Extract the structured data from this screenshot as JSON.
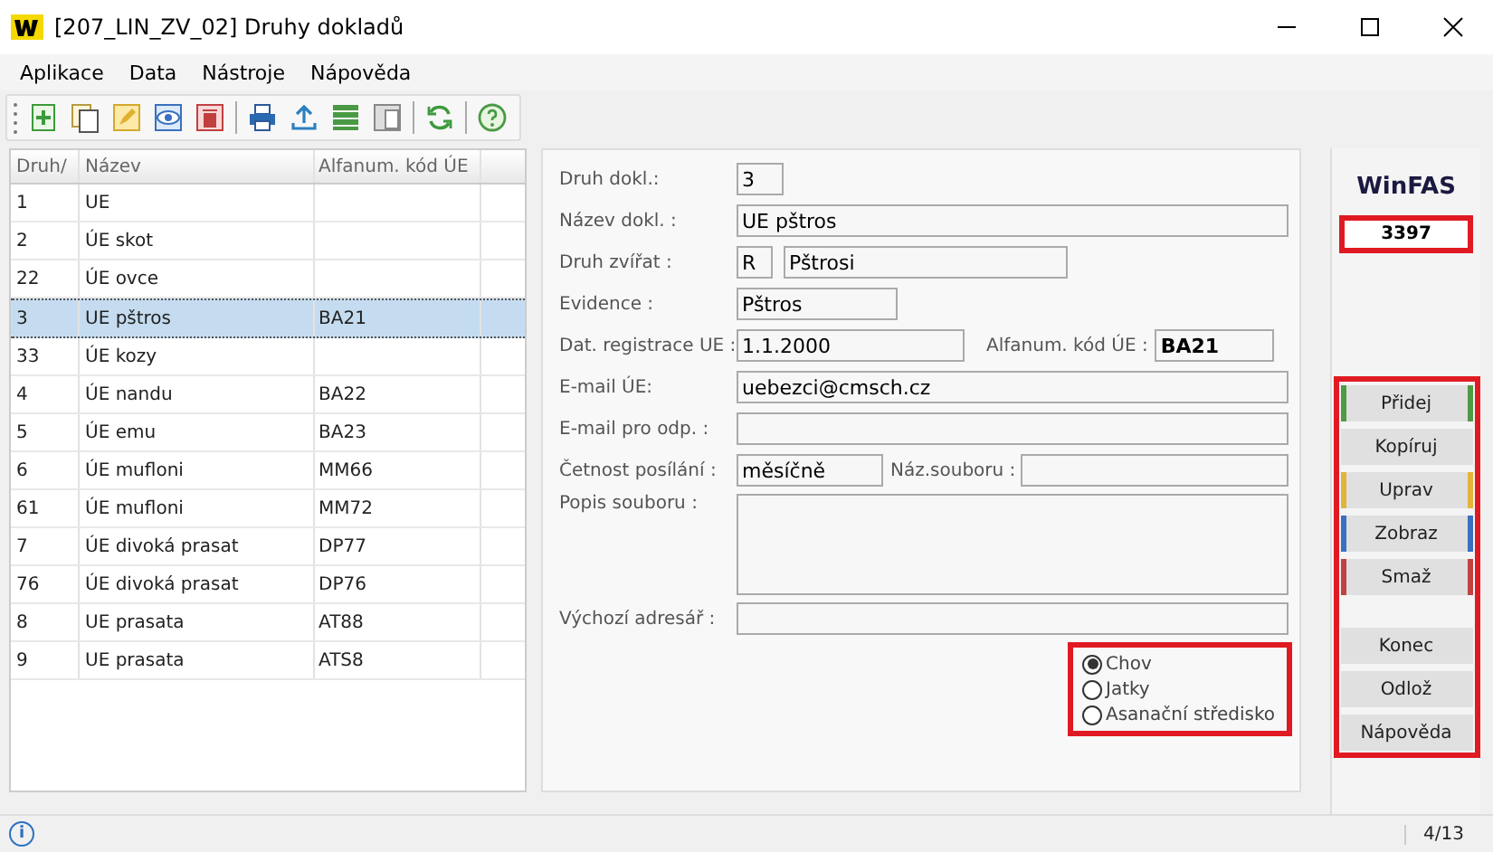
{
  "window": {
    "title": "[207_LIN_ZV_02] Druhy dokladů"
  },
  "menu": [
    "Aplikace",
    "Data",
    "Nástroje",
    "Nápověda"
  ],
  "table": {
    "columns": [
      "Druh/",
      "Název",
      "Alfanum. kód ÚE"
    ],
    "rows": [
      {
        "cells": [
          "1",
          "UE",
          ""
        ],
        "selected": false
      },
      {
        "cells": [
          "2",
          "ÚE skot",
          ""
        ],
        "selected": false
      },
      {
        "cells": [
          "22",
          "ÚE ovce",
          ""
        ],
        "selected": false
      },
      {
        "cells": [
          "3",
          "UE pštros",
          "BA21"
        ],
        "selected": true
      },
      {
        "cells": [
          "33",
          "ÚE kozy",
          ""
        ],
        "selected": false
      },
      {
        "cells": [
          "4",
          "ÚE nandu",
          "BA22"
        ],
        "selected": false
      },
      {
        "cells": [
          "5",
          "ÚE emu",
          "BA23"
        ],
        "selected": false
      },
      {
        "cells": [
          "6",
          "ÚE mufloni",
          "MM66"
        ],
        "selected": false
      },
      {
        "cells": [
          "61",
          "ÚE mufloni",
          "MM72"
        ],
        "selected": false
      },
      {
        "cells": [
          "7",
          "ÚE divoká prasat",
          "DP77"
        ],
        "selected": false
      },
      {
        "cells": [
          "76",
          "ÚE divoká prasat",
          "DP76"
        ],
        "selected": false
      },
      {
        "cells": [
          "8",
          "UE prasata",
          "AT88"
        ],
        "selected": false
      },
      {
        "cells": [
          "9",
          "UE prasata",
          "ATS8"
        ],
        "selected": false
      }
    ]
  },
  "form": {
    "druh": {
      "label": "Druh dokl.:",
      "value": "3"
    },
    "nazev": {
      "label": "Název dokl.  :",
      "value": "UE pštros"
    },
    "zvirat": {
      "label": "Druh zvířat  :",
      "code": "R",
      "value": "Pštrosi"
    },
    "evidence": {
      "label": "Evidence  :",
      "value": "Pštros"
    },
    "registrace": {
      "label": "Dat. registrace UE :",
      "value": "1.1.2000"
    },
    "alfanum": {
      "label": "Alfanum. kód ÚE :",
      "value": "BA21"
    },
    "email": {
      "label": "E-mail ÚE:",
      "value": "uebezci@cmsch.cz"
    },
    "email_odp": {
      "label": "E-mail pro odp. :"
    },
    "cetnost": {
      "label": "Četnost posílání :",
      "value": "měsíčně"
    },
    "soubor": {
      "label": "Náz.souboru :"
    },
    "popis": {
      "label": "Popis souboru :"
    },
    "adresar": {
      "label": "Výchozí adresář :"
    },
    "radios": [
      {
        "label": "Chov",
        "selected": true
      },
      {
        "label": "Jatky",
        "selected": false
      },
      {
        "label": "Asanační středisko",
        "selected": false
      }
    ]
  },
  "logo": "WinFAS",
  "counter": "3397",
  "buttons": [
    {
      "label": "Přidej",
      "color": "#4f9a45"
    },
    {
      "label": "Kopíruj"
    },
    {
      "label": "Uprav",
      "color": "#e2b43a"
    },
    {
      "label": "Zobraz",
      "color": "#3a70c0"
    },
    {
      "label": "Smaž",
      "color": "#c0433f"
    },
    {
      "label": "Konec",
      "gap": true
    },
    {
      "label": "Odlož"
    },
    {
      "label": "Nápověda"
    }
  ],
  "status_bar": {
    "info": "i",
    "position": "4/13"
  }
}
